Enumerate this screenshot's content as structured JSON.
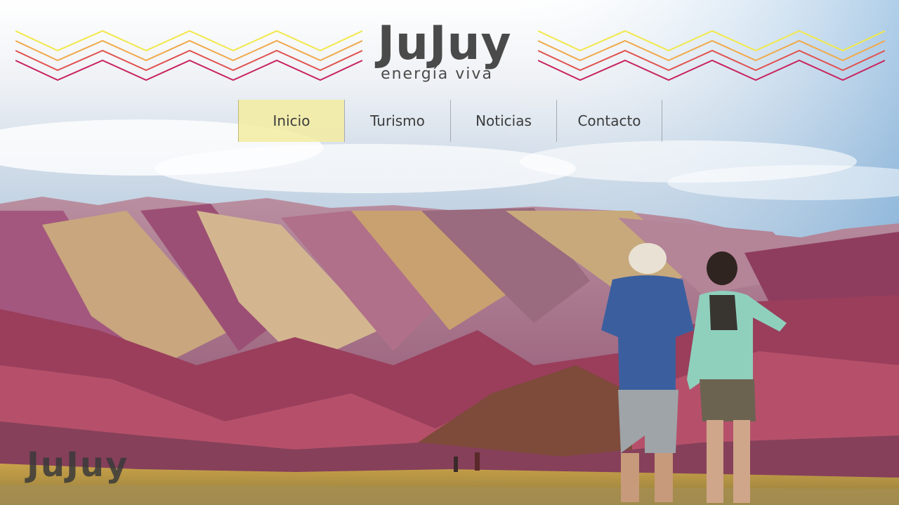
{
  "brand": {
    "name": "JuJuy",
    "tagline": "energía viva"
  },
  "nav": {
    "items": [
      {
        "label": "Inicio",
        "active": true
      },
      {
        "label": "Turismo",
        "active": false
      },
      {
        "label": "Noticias",
        "active": false
      },
      {
        "label": "Contacto",
        "active": false
      }
    ]
  },
  "footer_logo": "JuJuy",
  "colors": {
    "nav_active_bg": "#f3eca0",
    "text_dark": "#3c3c3c",
    "zigzag": [
      "#f2e84a",
      "#f0a94a",
      "#e0524f",
      "#c8245d"
    ]
  }
}
